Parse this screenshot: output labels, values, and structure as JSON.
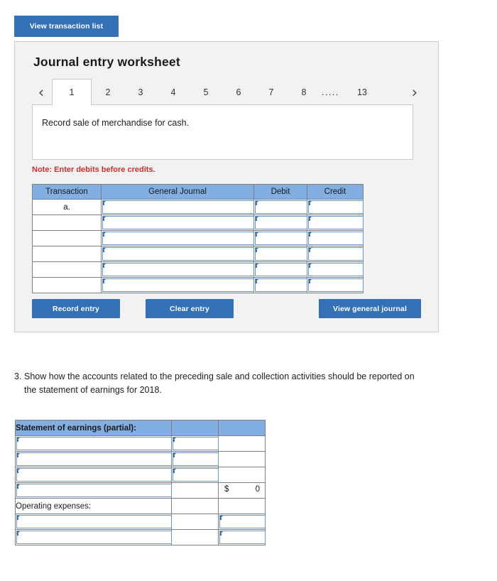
{
  "top_button": {
    "label": "View transaction list"
  },
  "worksheet": {
    "title": "Journal entry worksheet",
    "prev_arrow": "‹",
    "next_arrow": "›",
    "tabs": [
      {
        "label": "1",
        "active": true
      },
      {
        "label": "2",
        "active": false
      },
      {
        "label": "3",
        "active": false
      },
      {
        "label": "4",
        "active": false
      },
      {
        "label": "5",
        "active": false
      },
      {
        "label": "6",
        "active": false
      },
      {
        "label": "7",
        "active": false
      },
      {
        "label": "8",
        "active": false
      }
    ],
    "tab_ellipsis": ".....",
    "tab_last": "13",
    "description": "Record sale of merchandise for cash.",
    "note": "Note: Enter debits before credits.",
    "table": {
      "headers": [
        "Transaction",
        "General Journal",
        "Debit",
        "Credit"
      ],
      "rows": [
        {
          "transaction": "a."
        },
        {
          "transaction": ""
        },
        {
          "transaction": ""
        },
        {
          "transaction": ""
        },
        {
          "transaction": ""
        },
        {
          "transaction": ""
        }
      ]
    },
    "buttons": {
      "record_entry": "Record entry",
      "clear_entry": "Clear entry",
      "view_general_journal": "View general journal"
    }
  },
  "question_3": {
    "number": "3.",
    "text": "Show how the accounts related to the preceding sale and collection activities should be reported on the statement of earnings for 2018."
  },
  "statement_of_earnings": {
    "header_label": "Statement of earnings (partial):",
    "operating_expenses_label": "Operating expenses:",
    "currency_symbol": "$",
    "total_value": "0"
  },
  "colors": {
    "button_blue": "#3470b5",
    "header_blue": "#82aee2",
    "input_border_blue": "#6b96c4",
    "panel_grey": "#f2f2f2",
    "note_red": "#c9302c"
  }
}
